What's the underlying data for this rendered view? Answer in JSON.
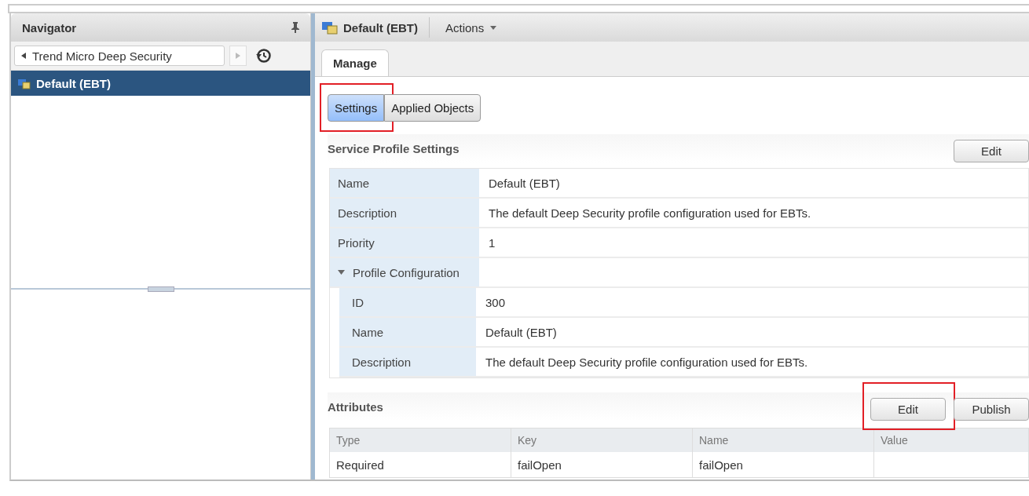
{
  "navigator": {
    "title": "Navigator",
    "breadcrumb": "Trend Micro Deep Security",
    "items": [
      {
        "label": "Default (EBT)",
        "selected": true
      }
    ]
  },
  "header": {
    "title": "Default (EBT)",
    "actions": "Actions"
  },
  "tabs": [
    {
      "label": "Manage",
      "selected": true
    }
  ],
  "subtabs": [
    {
      "label": "Settings",
      "selected": true,
      "highlighted": true
    },
    {
      "label": "Applied Objects",
      "selected": false,
      "highlighted": false
    }
  ],
  "service_profile": {
    "title": "Service Profile Settings",
    "edit_button": {
      "label": "Edit",
      "highlighted": false
    },
    "properties": [
      {
        "label": "Name",
        "value": "Default (EBT)"
      },
      {
        "label": "Description",
        "value": "The default Deep Security profile configuration used for EBTs."
      },
      {
        "label": "Priority",
        "value": "1"
      },
      {
        "label": "Profile Configuration",
        "expanded": true,
        "children": [
          {
            "label": "ID",
            "value": "300"
          },
          {
            "label": "Name",
            "value": "Default (EBT)"
          },
          {
            "label": "Description",
            "value": "The default Deep Security profile configuration used for EBTs."
          }
        ]
      }
    ]
  },
  "attributes": {
    "title": "Attributes",
    "buttons": [
      {
        "label": "Edit",
        "highlighted": true
      },
      {
        "label": "Publish",
        "highlighted": false
      }
    ],
    "columns": [
      "Type",
      "Key",
      "Name",
      "Value"
    ],
    "rows": [
      [
        "Required",
        "failOpen",
        "failOpen"
      ]
    ]
  }
}
